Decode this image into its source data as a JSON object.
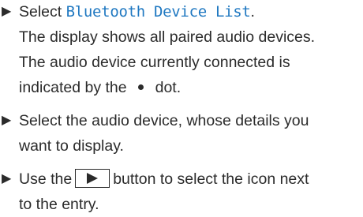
{
  "steps": [
    {
      "bullet": "▶",
      "prefix": "Select ",
      "code": "Bluetooth Device List",
      "suffix": ".",
      "line2": "The display shows all paired audio devices.",
      "line3": "The audio device currently connected is",
      "line4_before": "indicated by the",
      "line4_after": "dot."
    },
    {
      "bullet": "▶",
      "line1": "Select the audio device, whose details you",
      "line2": "want to display."
    },
    {
      "bullet": "▶",
      "before_button": "Use the",
      "after_button": "button to select the icon next",
      "line2": "to the entry."
    }
  ],
  "icons": {
    "bullet_icon": "triangle-right",
    "connected_dot_icon": "filled-circle",
    "play_button_icon": "triangle-right-in-box"
  },
  "colors": {
    "text": "#2b2b2b",
    "highlight": "#1f78c1"
  }
}
